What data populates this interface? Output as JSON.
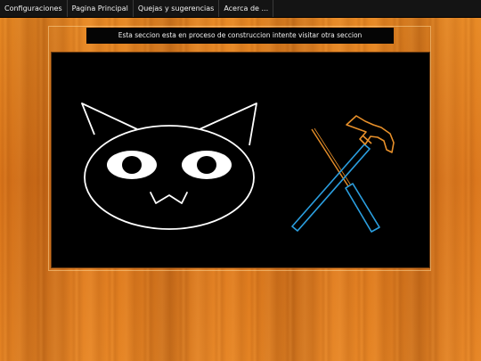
{
  "nav": {
    "items": [
      {
        "label": "Configuraciones"
      },
      {
        "label": "Pagina Principal"
      },
      {
        "label": "Quejas y sugerencias"
      },
      {
        "label": "Acerca de ..."
      }
    ]
  },
  "notice": {
    "text": "Esta seccion esta en proceso de construccion intente visitar otra seccion"
  },
  "colors": {
    "wood_background": "#e0801e",
    "navbar": "#141414",
    "panel": "#000000",
    "cat_outline": "#ffffff",
    "hammer": "#e8902a",
    "screwdriver": "#2b9fe0"
  },
  "illustration": {
    "left_icon": "cat-face-icon",
    "right_icon": "hammer-screwdriver-icon"
  }
}
